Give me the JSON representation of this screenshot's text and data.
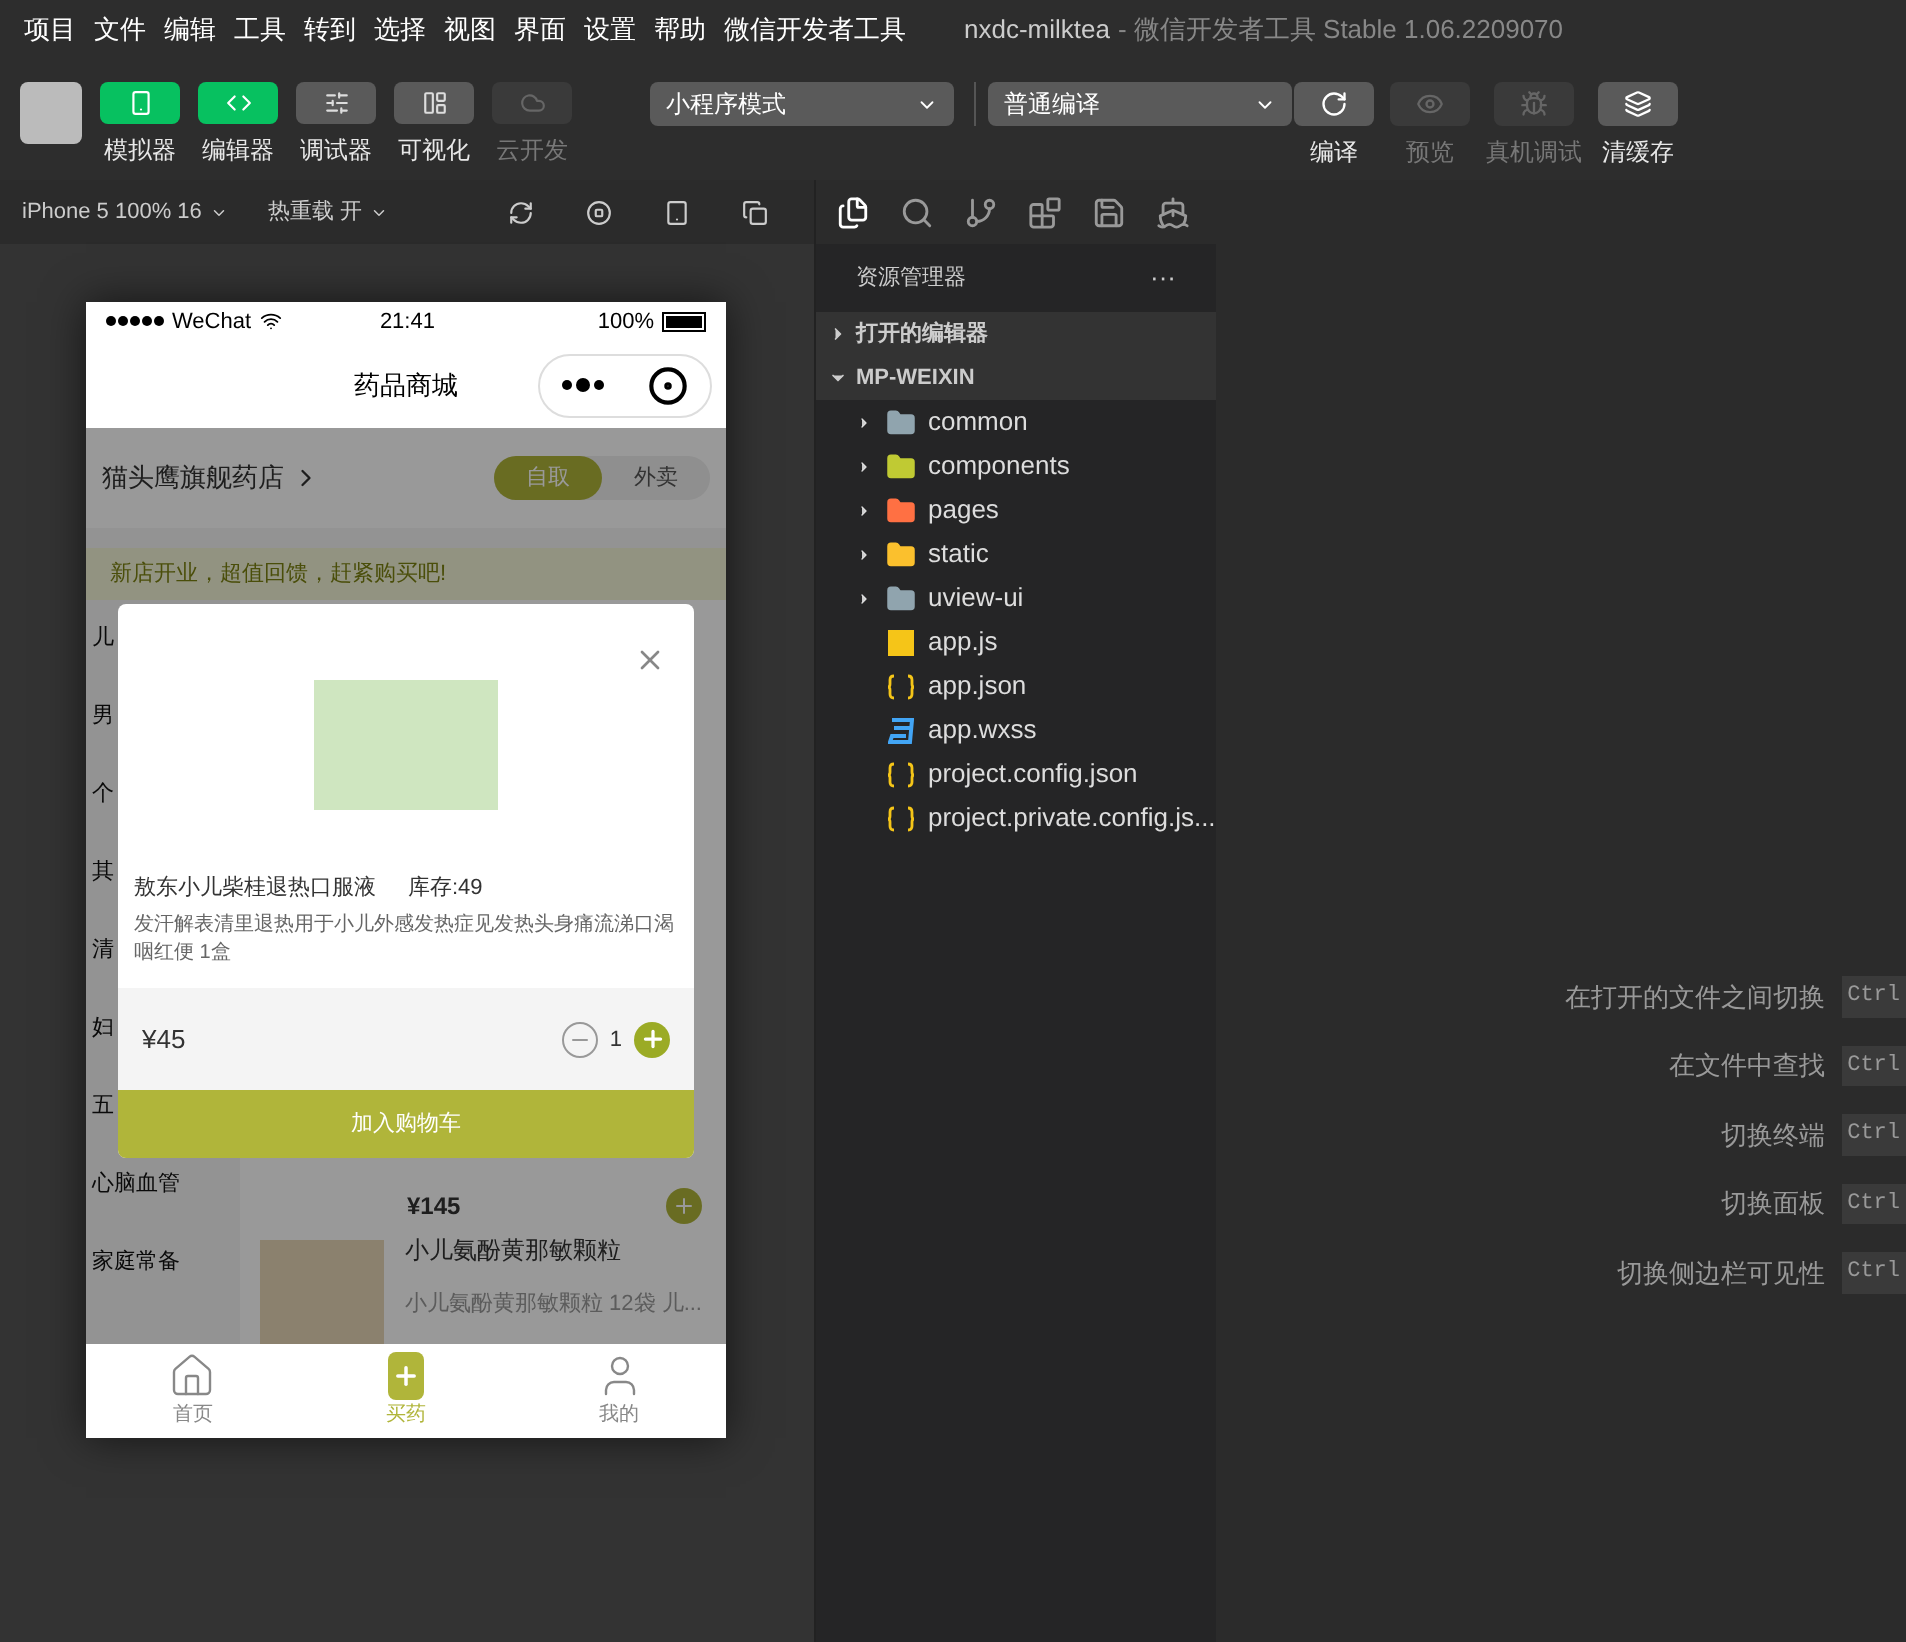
{
  "menu": [
    "项目",
    "文件",
    "编辑",
    "工具",
    "转到",
    "选择",
    "视图",
    "界面",
    "设置",
    "帮助",
    "微信开发者工具"
  ],
  "window": {
    "title": "nxdc-milktea",
    "subtitle": "- 微信开发者工具 Stable 1.06.2209070"
  },
  "toolbar_left": [
    {
      "label": "模拟器",
      "kind": "active"
    },
    {
      "label": "编辑器",
      "kind": "active"
    },
    {
      "label": "调试器",
      "kind": "normal"
    },
    {
      "label": "可视化",
      "kind": "normal"
    },
    {
      "label": "云开发",
      "kind": "disabled"
    }
  ],
  "mode_select": "小程序模式",
  "compile_select": "普通编译",
  "toolbar_right": [
    {
      "label": "编译",
      "disabled": false
    },
    {
      "label": "预览",
      "disabled": true
    },
    {
      "label": "真机调试",
      "disabled": true
    },
    {
      "label": "清缓存",
      "disabled": false
    }
  ],
  "simulator_bar": {
    "device": "iPhone 5 100% 16",
    "hot_reload": "热重载 开"
  },
  "phone": {
    "carrier": "WeChat",
    "time": "21:41",
    "battery": "100%",
    "nav_title": "药品商城",
    "store": "猫头鹰旗舰药店",
    "pickup_tabs": [
      {
        "label": "自取",
        "selected": true
      },
      {
        "label": "外卖",
        "selected": false
      }
    ],
    "notice": "新店开业，超值回馈，赶紧购买吧!",
    "categories": [
      "儿",
      "男",
      "个",
      "其",
      "清",
      "妇",
      "五",
      "心脑血管",
      "家庭常备"
    ],
    "products": [
      {
        "price": "¥145"
      },
      {
        "name": "小儿氨酚黄那敏颗粒",
        "desc": "小儿氨酚黄那敏颗粒 12袋 儿..."
      }
    ],
    "modal": {
      "name": "敖东小儿柴桂退热口服液",
      "stock": "库存:49",
      "desc": "发汗解表清里退热用于小儿外感发热症见发热头身痛流涕口渴咽红便 1盒",
      "price": "¥45",
      "quantity": "1",
      "button": "加入购物车"
    },
    "tabbar": [
      {
        "label": "首页",
        "selected": false
      },
      {
        "label": "买药",
        "selected": true
      },
      {
        "label": "我的",
        "selected": false
      }
    ]
  },
  "explorer": {
    "title": "资源管理器",
    "more": "···",
    "open_editors": {
      "label": "打开的编辑器",
      "expanded": false
    },
    "project": {
      "label": "MP-WEIXIN",
      "expanded": true,
      "children": [
        {
          "name": "common",
          "kind": "folder"
        },
        {
          "name": "components",
          "kind": "components"
        },
        {
          "name": "pages",
          "kind": "pages"
        },
        {
          "name": "static",
          "kind": "static"
        },
        {
          "name": "uview-ui",
          "kind": "folder"
        },
        {
          "name": "app.js",
          "kind": "js"
        },
        {
          "name": "app.json",
          "kind": "json"
        },
        {
          "name": "app.wxss",
          "kind": "css"
        },
        {
          "name": "project.config.json",
          "kind": "json"
        },
        {
          "name": "project.private.config.js...",
          "kind": "json"
        }
      ]
    }
  },
  "shortcuts": [
    {
      "label": "在打开的文件之间切换",
      "key": "Ctrl"
    },
    {
      "label": "在文件中查找",
      "key": "Ctrl"
    },
    {
      "label": "切换终端",
      "key": "Ctrl"
    },
    {
      "label": "切换面板",
      "key": "Ctrl"
    },
    {
      "label": "切换侧边栏可见性",
      "key": "Ctrl"
    }
  ]
}
